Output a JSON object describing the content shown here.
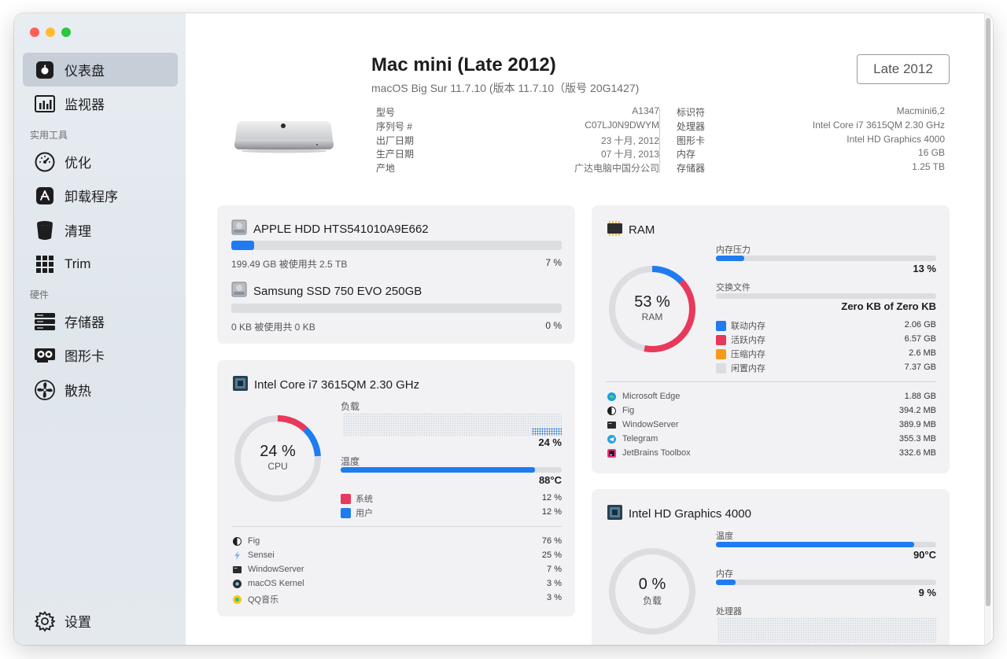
{
  "sidebar": {
    "items": [
      {
        "label": "仪表盘"
      },
      {
        "label": "监视器"
      },
      {
        "label": "优化"
      },
      {
        "label": "卸载程序"
      },
      {
        "label": "清理"
      },
      {
        "label": "Trim"
      },
      {
        "label": "存储器"
      },
      {
        "label": "图形卡"
      },
      {
        "label": "散热"
      }
    ],
    "section_tools": "实用工具",
    "section_hardware": "硬件",
    "settings_label": "设置"
  },
  "header": {
    "title": "Mac mini (Late 2012)",
    "subtitle": "macOS Big Sur 11.7.10 (版本 11.7.10（版号 20G1427)",
    "year_button": "Late 2012"
  },
  "specs_left": [
    {
      "k": "型号",
      "v": "A1347"
    },
    {
      "k": "序列号 #",
      "v": "C07LJ0N9DWYM"
    },
    {
      "k": "出厂日期",
      "v": "23 十月, 2012"
    },
    {
      "k": "生产日期",
      "v": "07 十月, 2013"
    },
    {
      "k": "产地",
      "v": "广达电脑中国分公司"
    }
  ],
  "specs_right": [
    {
      "k": "标识符",
      "v": "Macmini6,2"
    },
    {
      "k": "处理器",
      "v": "Intel Core i7 3615QM 2.30 GHz"
    },
    {
      "k": "图形卡",
      "v": "Intel HD Graphics 4000"
    },
    {
      "k": "内存",
      "v": "16 GB"
    },
    {
      "k": "存储器",
      "v": "1.25 TB"
    }
  ],
  "storage": {
    "disks": [
      {
        "name": "APPLE HDD HTS541010A9E662",
        "usage": "199.49 GB 被使用共 2.5 TB",
        "pct_label": "7 %",
        "fraction": 0.07
      },
      {
        "name": "Samsung SSD 750 EVO 250GB",
        "usage": "0 KB 被使用共 0 KB",
        "pct_label": "0 %",
        "fraction": 0.0
      }
    ]
  },
  "cpu": {
    "name": "Intel Core i7 3615QM 2.30 GHz",
    "ring_value": "24 %",
    "ring_label": "CPU",
    "load_label": "负载",
    "load_pct": "24 %",
    "temp_label": "温度",
    "temp_value": "88°C",
    "temp_fraction": 0.88,
    "system_fraction": 0.12,
    "user_fraction": 0.12,
    "legend": [
      {
        "label": "系统",
        "value": "12 %",
        "color": "#e8395a"
      },
      {
        "label": "用户",
        "value": "12 %",
        "color": "#1e7cf0"
      }
    ],
    "processes": [
      {
        "name": "Fig",
        "value": "76 %",
        "icon": "fig-icon"
      },
      {
        "name": "Sensei",
        "value": "25 %",
        "icon": "sensei-icon"
      },
      {
        "name": "WindowServer",
        "value": "7 %",
        "icon": "windowserver-icon"
      },
      {
        "name": "macOS Kernel",
        "value": "3 %",
        "icon": "kernel-icon"
      },
      {
        "name": "QQ音乐",
        "value": "3 %",
        "icon": "qqmusic-icon"
      }
    ]
  },
  "ram": {
    "name": "RAM",
    "ring_value": "53 %",
    "ring_label": "RAM",
    "pressure_label": "内存压力",
    "pressure_pct": "13 %",
    "pressure_fraction": 0.13,
    "swap_label": "交换文件",
    "swap_value": "Zero KB of Zero KB",
    "swap_fraction": 0.0,
    "wired_fraction": 0.13,
    "active_fraction": 0.4,
    "legend": [
      {
        "label": "联动内存",
        "value": "2.06 GB",
        "color": "#1e7cf0"
      },
      {
        "label": "活跃内存",
        "value": "6.57 GB",
        "color": "#e8395a"
      },
      {
        "label": "压缩内存",
        "value": "2.6 MB",
        "color": "#f59a16"
      },
      {
        "label": "闲置内存",
        "value": "7.37 GB",
        "color": "#dcdde0"
      }
    ],
    "processes": [
      {
        "name": "Microsoft Edge",
        "value": "1.88 GB",
        "icon": "edge-icon"
      },
      {
        "name": "Fig",
        "value": "394.2 MB",
        "icon": "fig-icon"
      },
      {
        "name": "WindowServer",
        "value": "389.9 MB",
        "icon": "windowserver-icon"
      },
      {
        "name": "Telegram",
        "value": "355.3 MB",
        "icon": "telegram-icon"
      },
      {
        "name": "JetBrains Toolbox",
        "value": "332.6 MB",
        "icon": "jetbrains-icon"
      }
    ]
  },
  "gpu": {
    "name": "Intel HD Graphics 4000",
    "ring_value": "0 %",
    "ring_label": "负载",
    "temp_label": "温度",
    "temp_value": "90°C",
    "temp_fraction": 0.9,
    "mem_label": "内存",
    "mem_value": "9 %",
    "mem_fraction": 0.09,
    "proc_label": "处理器"
  },
  "colors": {
    "accent": "#1e7cf0",
    "red": "#e8395a",
    "orange": "#f59a16"
  }
}
